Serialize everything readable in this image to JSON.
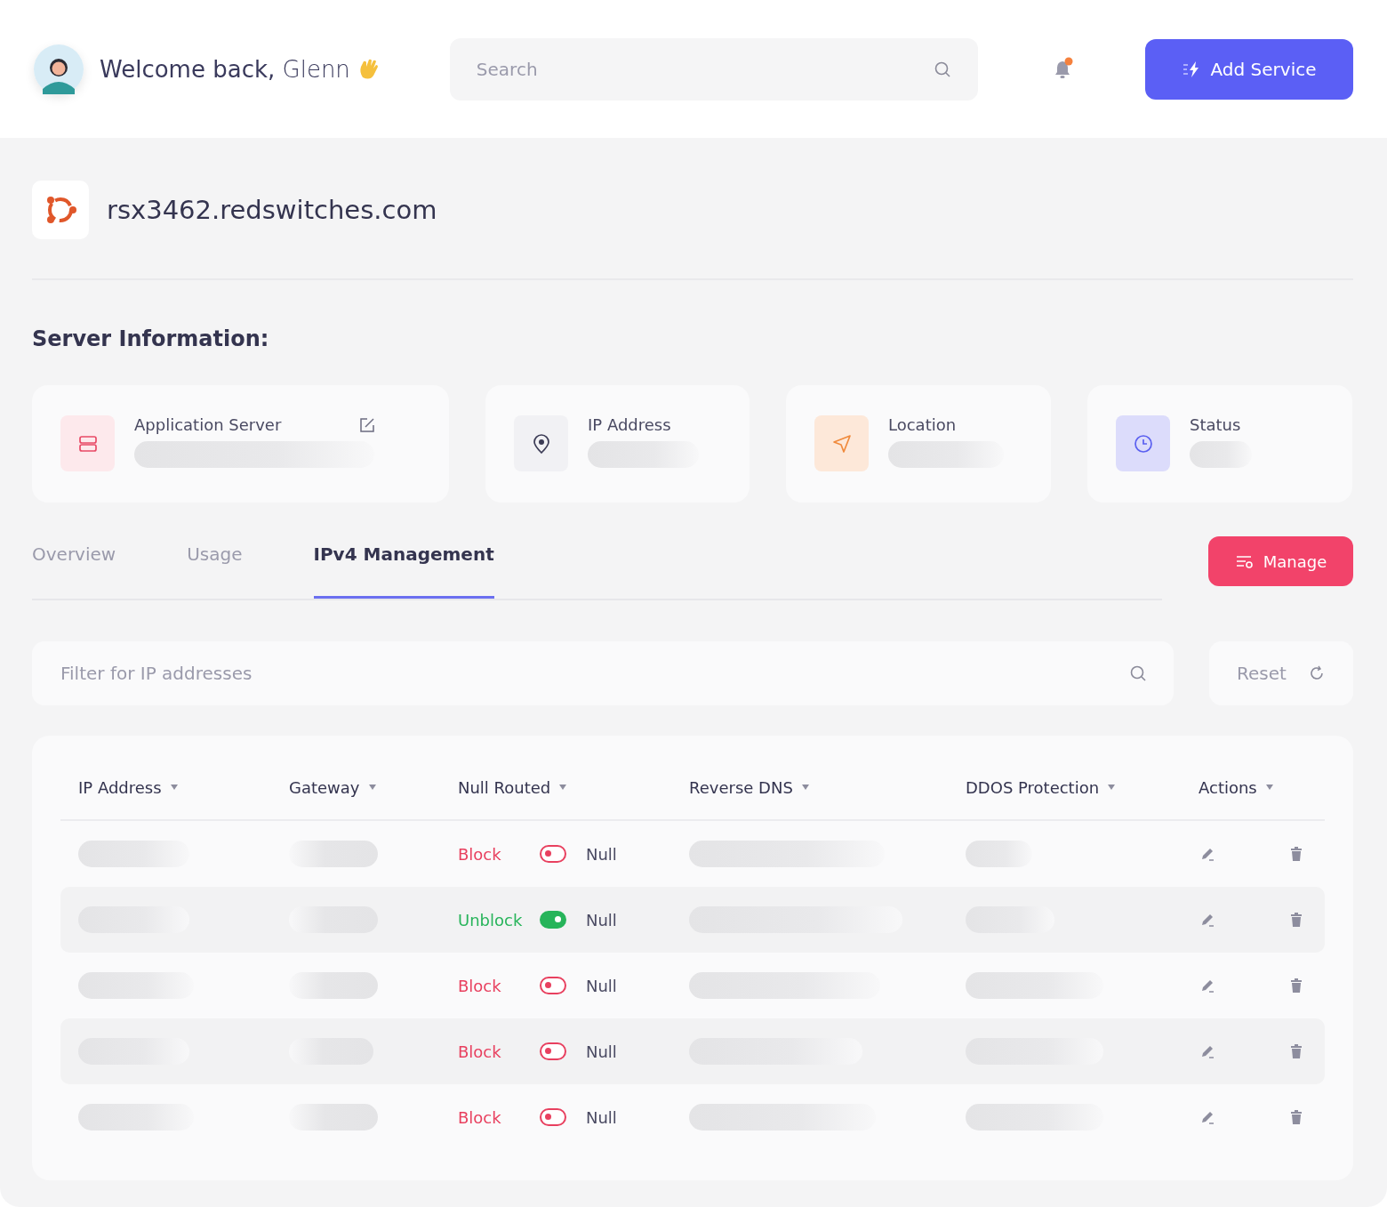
{
  "header": {
    "greeting": "**Welcome back,** Glenn",
    "search": {
      "placeholder": "Search"
    },
    "notification_dot": true,
    "add_button": "Add Service"
  },
  "server": {
    "hostname": "rsx3462.redswitches.com"
  },
  "section_title": "Server Information:",
  "info_cards": [
    {
      "kind": "server",
      "label": "Application Server",
      "editable": true
    },
    {
      "kind": "ip",
      "label": "IP Address",
      "editable": false
    },
    {
      "kind": "location",
      "label": "Location",
      "editable": false
    },
    {
      "kind": "status",
      "label": "Status",
      "editable": false
    }
  ],
  "tabs": [
    {
      "label": "Overview",
      "selected": false
    },
    {
      "label": "Usage",
      "selected": false
    },
    {
      "label": "IPv4 Management",
      "selected": true
    }
  ],
  "manage_button": "Manage",
  "filter": {
    "placeholder": "Filter for IP addresses"
  },
  "reset_button": "Reset",
  "table": {
    "columns": [
      "IP Address",
      "Gateway",
      "Null Routed",
      "Reverse DNS",
      "DDOS Protection",
      "Actions"
    ],
    "rows": [
      {
        "action": "Block",
        "on": false,
        "route": "Null"
      },
      {
        "action": "Unblock",
        "on": true,
        "route": "Null"
      },
      {
        "action": "Block",
        "on": false,
        "route": "Null"
      },
      {
        "action": "Block",
        "on": false,
        "route": "Null"
      },
      {
        "action": "Block",
        "on": false,
        "route": "Null"
      }
    ]
  }
}
